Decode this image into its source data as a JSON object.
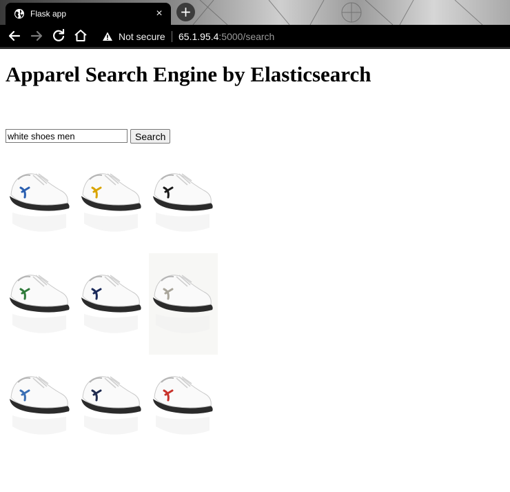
{
  "browser": {
    "tab_title": "Flask app",
    "tab_close": "×",
    "new_tab": "+",
    "security_label": "Not secure",
    "url_host": "65.1.95.4",
    "url_path": ":5000/search"
  },
  "page": {
    "title": "Apparel Search Engine by Elasticsearch",
    "search": {
      "value": "white shoes men",
      "button_label": "Search"
    }
  },
  "results": [
    {
      "alt": "white sneaker with blue logo",
      "accent": "#2a5fb0"
    },
    {
      "alt": "white sneaker with yellow logo",
      "accent": "#d9a400"
    },
    {
      "alt": "white sneaker with black stripes",
      "accent": "#1a1a1a"
    },
    {
      "alt": "white sneaker with green trim",
      "accent": "#2f7a3a"
    },
    {
      "alt": "white sneaker with navy and red trim",
      "accent": "#1b2a5a"
    },
    {
      "alt": "grey suede sneaker",
      "accent": "#a8a49a"
    },
    {
      "alt": "white sneaker with blue badge",
      "accent": "#3a6fb5"
    },
    {
      "alt": "white sneaker with navy strap",
      "accent": "#1f2b4f"
    },
    {
      "alt": "white and beige sneaker with red stripe",
      "accent": "#c8332c"
    }
  ],
  "colors": {
    "chrome_bg": "#000000",
    "host_text": "#ffffff",
    "path_text": "#9a9a9a"
  }
}
